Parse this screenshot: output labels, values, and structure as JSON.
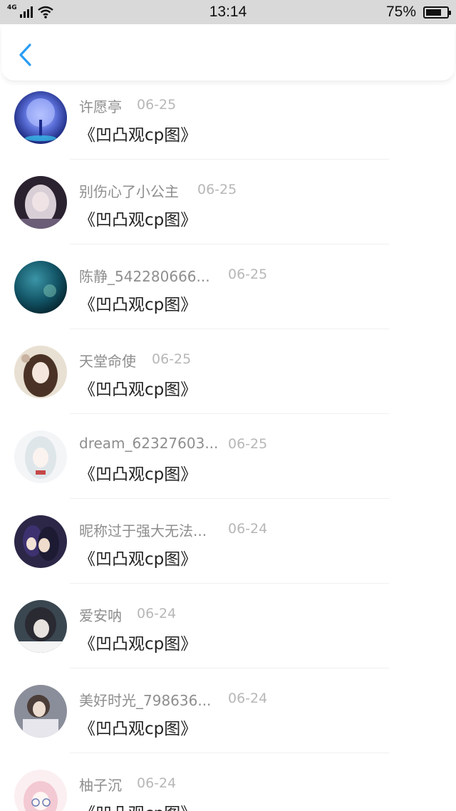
{
  "status_bar": {
    "network": "4G",
    "time": "13:14",
    "battery_text": "75%",
    "battery_level": 0.75
  },
  "nav": {
    "back_icon": "chevron-left-icon",
    "accent": "#2a9df4"
  },
  "items": [
    {
      "name": "许愿亭",
      "date": "06-25",
      "title": "《凹凸观cp图》"
    },
    {
      "name": "别伤心了小公主",
      "date": "06-25",
      "title": "《凹凸观cp图》"
    },
    {
      "name": "陈静_542280666...",
      "date": "06-25",
      "title": "《凹凸观cp图》"
    },
    {
      "name": "天堂命使",
      "date": "06-25",
      "title": "《凹凸观cp图》"
    },
    {
      "name": "dream_62327603...",
      "date": "06-25",
      "title": "《凹凸观cp图》"
    },
    {
      "name": "昵称过于强大无法...",
      "date": "06-24",
      "title": "《凹凸观cp图》"
    },
    {
      "name": "爱安呐",
      "date": "06-24",
      "title": "《凹凸观cp图》"
    },
    {
      "name": "美好时光_798636...",
      "date": "06-24",
      "title": "《凹凸观cp图》"
    },
    {
      "name": "柚子沉",
      "date": "06-24",
      "title": "《凹凸观cp图》"
    }
  ]
}
